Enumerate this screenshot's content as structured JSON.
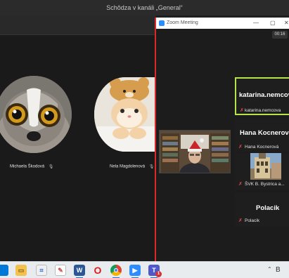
{
  "teams": {
    "window_title": "Schôdza v kanáli „General“",
    "participants": [
      {
        "name": "Michaela Škodová",
        "muted": true
      },
      {
        "name": "Nela Magdolenová",
        "muted": true
      }
    ]
  },
  "zoom": {
    "title": "Zoom Meeting",
    "timer": "00:16",
    "participants": [
      {
        "display": "katarina.nemcova",
        "name": "katarina.nemcova",
        "muted": true,
        "active_speaker": true
      },
      {
        "display": "Hana Kocnerová",
        "name": "Hana Kocnerová",
        "muted": true
      },
      {
        "display": "",
        "name": "ŠVK B. Bystrica a...",
        "muted": true,
        "has_video": true
      },
      {
        "display": "Polacik",
        "name": "Polacik",
        "muted": true
      }
    ]
  },
  "taskbar": {
    "right_text": "B",
    "icons": [
      "windows-start-icon",
      "file-explorer-icon",
      "photos-icon",
      "paint-icon",
      "word-icon",
      "opera-icon",
      "chrome-icon",
      "zoom-icon",
      "teams-icon"
    ],
    "teams_badge": "1"
  },
  "colors": {
    "zoom_border": "#d9292d",
    "active_speaker": "#b7e34a",
    "zoom_blue": "#2d8cff"
  }
}
